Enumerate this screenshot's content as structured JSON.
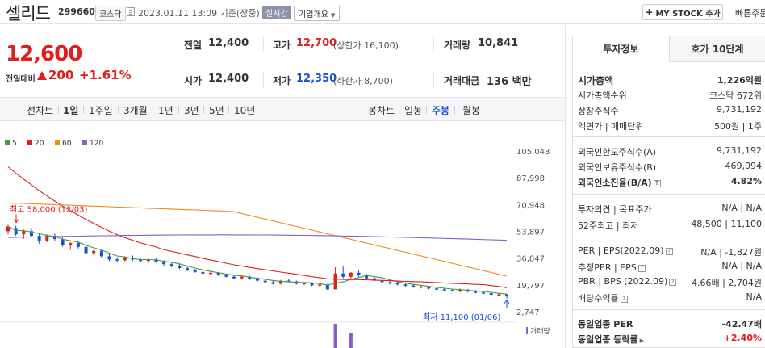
{
  "header": {
    "name": "셀리드",
    "code": "299660",
    "market": "코스닥",
    "timestamp": "2023.01.11 13:09 기준(장중)",
    "realtime": "실시간",
    "company_overview": "기업개요",
    "mystock": "MY STOCK 추가",
    "quick_order": "빠른주문"
  },
  "price": {
    "current": "12,600",
    "change_label": "전일대비",
    "change": "200",
    "change_pct": "+1.61%"
  },
  "quote": {
    "prev_label": "전일",
    "prev": "12,400",
    "high_label": "고가",
    "high": "12,700",
    "upper_limit": "(상한가 16,100)",
    "volume_label": "거래량",
    "volume": "10,841",
    "open_label": "시가",
    "open": "12,400",
    "low_label": "저가",
    "low": "12,350",
    "lower_limit": "(하한가 8,700)",
    "amount_label": "거래대금",
    "amount": "136 백만"
  },
  "toolbar": {
    "line_label": "선차트",
    "periods": [
      "1일",
      "1주일",
      "3개월",
      "1년",
      "3년",
      "5년",
      "10년"
    ],
    "candle_label": "봉차트",
    "candles": [
      "일봉",
      "주봉",
      "월봉"
    ],
    "active_candle": "주봉"
  },
  "chart_data": {
    "type": "line",
    "legend": [
      {
        "name": "5",
        "color": "#3aa03a"
      },
      {
        "name": "20",
        "color": "#e01e1e"
      },
      {
        "name": "60",
        "color": "#f08a1c"
      },
      {
        "name": "120",
        "color": "#8a5cc8"
      }
    ],
    "y_ticks": [
      "105,048",
      "87,998",
      "70,948",
      "53,897",
      "36,847",
      "19,797",
      "2,747"
    ],
    "ylim": [
      2747,
      105048
    ],
    "annotations": {
      "high": "최고 58,000 (12/03)",
      "low": "최저 11,100 (01/06)"
    },
    "volume_label": "거래량",
    "candles": [
      [
        54000,
        58000,
        52000,
        57000
      ],
      [
        56000,
        57500,
        51000,
        52000
      ],
      [
        52000,
        55000,
        49000,
        54000
      ],
      [
        54000,
        56000,
        50000,
        51000
      ],
      [
        51000,
        53000,
        46000,
        48000
      ],
      [
        48000,
        52000,
        47000,
        51000
      ],
      [
        51000,
        52500,
        47500,
        49000
      ],
      [
        49000,
        50000,
        44000,
        45000
      ],
      [
        45000,
        47000,
        42000,
        46500
      ],
      [
        46500,
        48000,
        43000,
        44000
      ],
      [
        44000,
        45000,
        39000,
        40000
      ],
      [
        40000,
        42500,
        38000,
        41500
      ],
      [
        41500,
        42000,
        37000,
        38000
      ],
      [
        38000,
        39500,
        35000,
        36000
      ],
      [
        36000,
        37500,
        34000,
        35500
      ],
      [
        35500,
        38000,
        34500,
        37000
      ],
      [
        37000,
        38500,
        35000,
        36000
      ],
      [
        36000,
        37000,
        34000,
        35000
      ],
      [
        35000,
        36500,
        33500,
        36000
      ],
      [
        36000,
        37000,
        34000,
        34500
      ],
      [
        34500,
        35500,
        32000,
        33000
      ],
      [
        33000,
        34000,
        31000,
        32000
      ],
      [
        32000,
        33000,
        30000,
        30500
      ],
      [
        30500,
        31500,
        28500,
        29000
      ],
      [
        29000,
        30000,
        27500,
        28000
      ],
      [
        28000,
        29000,
        26500,
        27000
      ],
      [
        27000,
        28500,
        26000,
        27500
      ],
      [
        27500,
        28000,
        25500,
        26000
      ],
      [
        26000,
        27000,
        24500,
        25000
      ],
      [
        25000,
        26000,
        23500,
        24000
      ],
      [
        24000,
        25500,
        23000,
        25000
      ],
      [
        25000,
        25500,
        23000,
        23500
      ],
      [
        23500,
        24500,
        22000,
        22500
      ],
      [
        22500,
        23500,
        21000,
        21500
      ],
      [
        21500,
        22500,
        20000,
        20500
      ],
      [
        20500,
        23000,
        20000,
        22500
      ],
      [
        22500,
        23500,
        21500,
        22000
      ],
      [
        22000,
        22500,
        20000,
        20500
      ],
      [
        20500,
        21500,
        19500,
        21000
      ],
      [
        21000,
        21500,
        19000,
        19500
      ],
      [
        19500,
        20500,
        18500,
        20000
      ],
      [
        20000,
        20500,
        16500,
        17000
      ],
      [
        17000,
        31000,
        16800,
        27000
      ],
      [
        27000,
        31500,
        24000,
        25000
      ],
      [
        25000,
        28000,
        23000,
        27500
      ],
      [
        27500,
        29000,
        25000,
        26000
      ],
      [
        26000,
        27000,
        23500,
        24000
      ],
      [
        24000,
        25000,
        22000,
        22500
      ],
      [
        22500,
        23500,
        21000,
        21500
      ],
      [
        21500,
        22500,
        20000,
        21000
      ],
      [
        21000,
        21800,
        19500,
        20000
      ],
      [
        20000,
        21000,
        18800,
        19500
      ],
      [
        19500,
        20000,
        18000,
        18500
      ],
      [
        18500,
        19500,
        17500,
        18800
      ],
      [
        18800,
        19200,
        17000,
        17500
      ],
      [
        17500,
        18500,
        16500,
        17000
      ],
      [
        17000,
        18000,
        16000,
        16500
      ],
      [
        16500,
        17000,
        15500,
        16000
      ],
      [
        16000,
        17500,
        15000,
        16800
      ],
      [
        16800,
        17000,
        15000,
        15500
      ],
      [
        15500,
        16500,
        14500,
        15000
      ],
      [
        15000,
        15500,
        14000,
        14500
      ],
      [
        14500,
        15000,
        13000,
        13500
      ],
      [
        13500,
        14500,
        12500,
        13800
      ],
      [
        13800,
        14200,
        11100,
        12600
      ]
    ],
    "volumes": [
      0,
      0,
      0,
      0,
      0,
      0,
      0,
      0,
      0,
      0,
      0,
      0,
      0,
      0,
      0,
      0,
      0,
      0,
      0,
      0,
      0,
      0,
      0,
      0,
      0,
      0,
      0,
      0,
      0,
      0,
      0,
      0,
      0,
      0,
      0,
      0,
      0,
      0,
      0,
      0,
      0,
      0,
      3,
      0,
      1.8,
      0,
      0,
      0,
      0,
      0,
      0,
      0,
      0,
      0,
      0,
      0,
      0,
      0,
      0,
      0,
      0,
      0,
      0,
      0,
      0
    ]
  },
  "invest": {
    "tab_invest": "투자정보",
    "tab_orderbook": "호가 10단계",
    "market_cap_label": "시가총액",
    "market_cap": "1,226억원",
    "cap_rank_label": "시가총액순위",
    "cap_rank": "코스닥 672위",
    "shares_label": "상장주식수",
    "shares": "9,731,192",
    "par_label": "액면가 | 매매단위",
    "par": "500원 | 1주",
    "foreign_limit_label": "외국인한도주식수(A)",
    "foreign_limit": "9,731,192",
    "foreign_hold_label": "외국인보유주식수(B)",
    "foreign_hold": "469,094",
    "foreign_ratio_label": "외국인소진율(B/A)",
    "foreign_ratio": "4.82%",
    "opinion_label": "투자의견 | 목표주가",
    "opinion": "N/A | N/A",
    "wk52_label": "52주최고 | 최저",
    "wk52": "48,500 | 11,100",
    "per_label": "PER | EPS(2022.09)",
    "per": "N/A | -1,827원",
    "est_per_label": "추정PER | EPS",
    "est_per": "N/A | N/A",
    "pbr_label": "PBR | BPS (2022.09)",
    "pbr": "4.66배 | 2,704원",
    "div_label": "배당수익률",
    "div": "N/A",
    "sector_per_label": "동일업종 PER",
    "sector_per": "-42.47배",
    "sector_rate_label": "동일업종 등락률",
    "sector_rate": "+2.40%"
  }
}
